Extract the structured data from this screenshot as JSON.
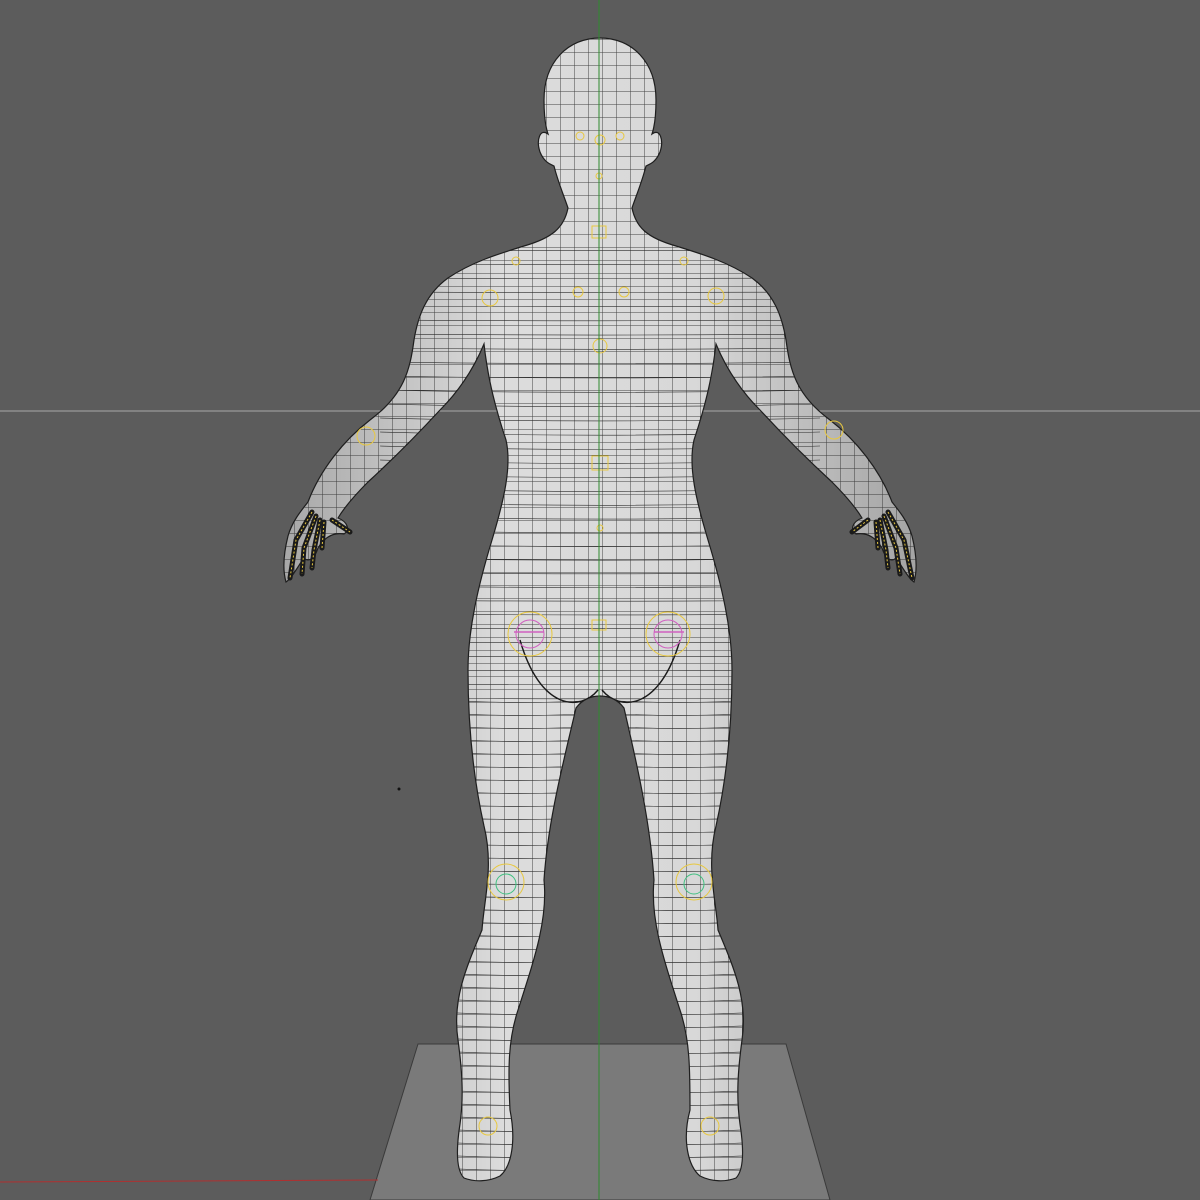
{
  "viewport": {
    "view": "back",
    "shading": "wireframe-on-shaded",
    "background_color": "#5c5c5c",
    "mesh_color": "#d2d2d2",
    "wire_color": "#1e1e1e",
    "ground_plane_color": "#7a7a7a",
    "axis_vertical_color": "#2e8b2e",
    "axis_horizontal_color": "#a8a8a8",
    "axis_x_color": "#b03030",
    "rig_marker_color": "#e8c840",
    "rig_marker_alt_colors": [
      "#d060c0",
      "#40c080"
    ]
  },
  "model": {
    "type": "human-base-mesh",
    "pose": "A-pose"
  }
}
